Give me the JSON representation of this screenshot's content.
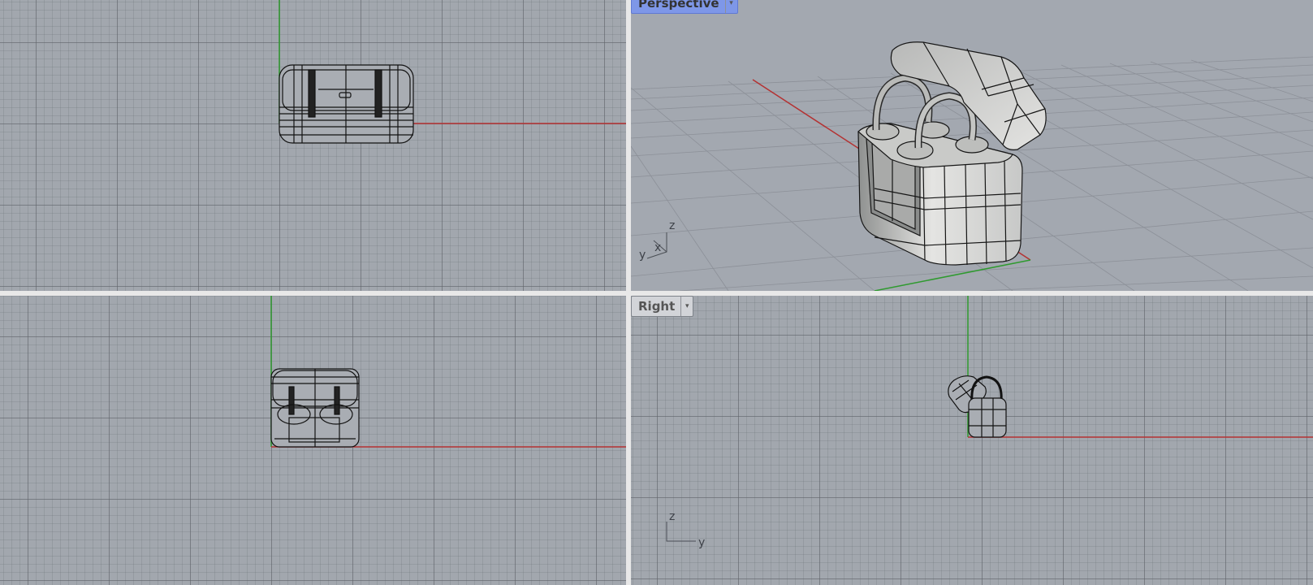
{
  "viewports": {
    "top": {
      "label": ""
    },
    "perspective": {
      "label": "Perspective"
    },
    "front": {
      "label": ""
    },
    "right": {
      "label": "Right"
    }
  },
  "menu_arrow_glyph": "▾",
  "axis_labels": {
    "x": "x",
    "y": "y",
    "z": "z"
  },
  "colors": {
    "viewport_bg": "#a2a7ae",
    "x_axis": "#b43232",
    "y_axis": "#2f9a2f",
    "active_tab": "#7e97e8",
    "model_shade": "#cfd0cf",
    "wire": "#121212"
  },
  "model": {
    "name_icon": "lunchbox-model-icon"
  }
}
